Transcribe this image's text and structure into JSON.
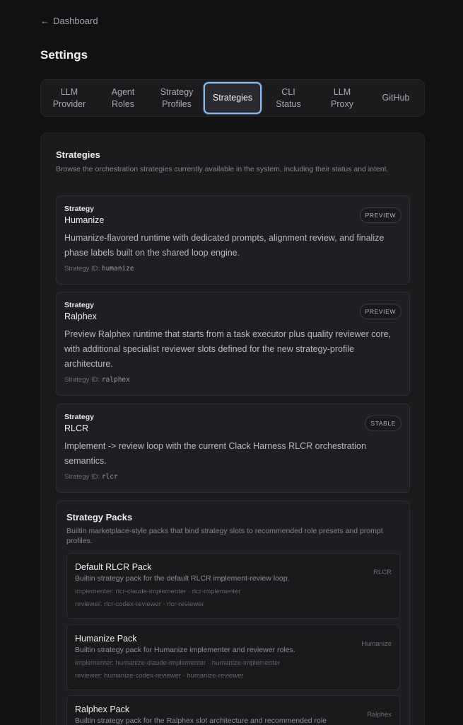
{
  "nav": {
    "back_label": "Dashboard"
  },
  "page": {
    "title": "Settings"
  },
  "tabs": [
    {
      "id": "llm-provider",
      "label": "LLM\nProvider",
      "active": false
    },
    {
      "id": "agent-roles",
      "label": "Agent\nRoles",
      "active": false
    },
    {
      "id": "strategy-profiles",
      "label": "Strategy\nProfiles",
      "active": false
    },
    {
      "id": "strategies",
      "label": "Strategies",
      "active": true
    },
    {
      "id": "cli-status",
      "label": "CLI\nStatus",
      "active": false
    },
    {
      "id": "llm-proxy",
      "label": "LLM\nProxy",
      "active": false
    },
    {
      "id": "github",
      "label": "GitHub",
      "active": false
    }
  ],
  "strategies_section": {
    "title": "Strategies",
    "description": "Browse the orchestration strategies currently available in the system, including their status and intent.",
    "id_label": "Strategy ID:",
    "items": [
      {
        "kicker": "Strategy",
        "name": "Humanize",
        "badge": "PREVIEW",
        "description": "Humanize-flavored runtime with dedicated prompts, alignment review, and finalize phase labels built on the shared loop engine.",
        "strategy_id": "humanize"
      },
      {
        "kicker": "Strategy",
        "name": "Ralphex",
        "badge": "PREVIEW",
        "description": "Preview Ralphex runtime that starts from a task executor plus quality reviewer core, with additional specialist reviewer slots defined for the new strategy-profile architecture.",
        "strategy_id": "ralphex"
      },
      {
        "kicker": "Strategy",
        "name": "RLCR",
        "badge": "STABLE",
        "description": "Implement -> review loop with the current Clack Harness RLCR orchestration semantics.",
        "strategy_id": "rlcr"
      }
    ]
  },
  "packs_section": {
    "title": "Strategy Packs",
    "description": "Builtin marketplace-style packs that bind strategy slots to recommended role presets and prompt profiles.",
    "items": [
      {
        "name": "Default RLCR Pack",
        "description": "Builtin strategy pack for the default RLCR implement-review loop.",
        "tag": "RLCR",
        "implementer": "implementer: rlcr-claude-implementer · rlcr-implementer",
        "reviewer": "reviewer: rlcr-codex-reviewer · rlcr-reviewer"
      },
      {
        "name": "Humanize Pack",
        "description": "Builtin strategy pack for Humanize implementer and reviewer roles.",
        "tag": "Humanize",
        "implementer": "implementer: humanize-claude-implementer · humanize-implementer",
        "reviewer": "reviewer: humanize-codex-reviewer · humanize-reviewer"
      },
      {
        "name": "Ralphex Pack",
        "description": "Builtin strategy pack for the Ralphex slot architecture and recommended role",
        "tag": "Ralphex",
        "implementer": "",
        "reviewer": ""
      }
    ]
  },
  "colors": {
    "background": "#111113",
    "panel": "#1b1b1e",
    "accent_active_tab_border": "#8fb7e8"
  }
}
